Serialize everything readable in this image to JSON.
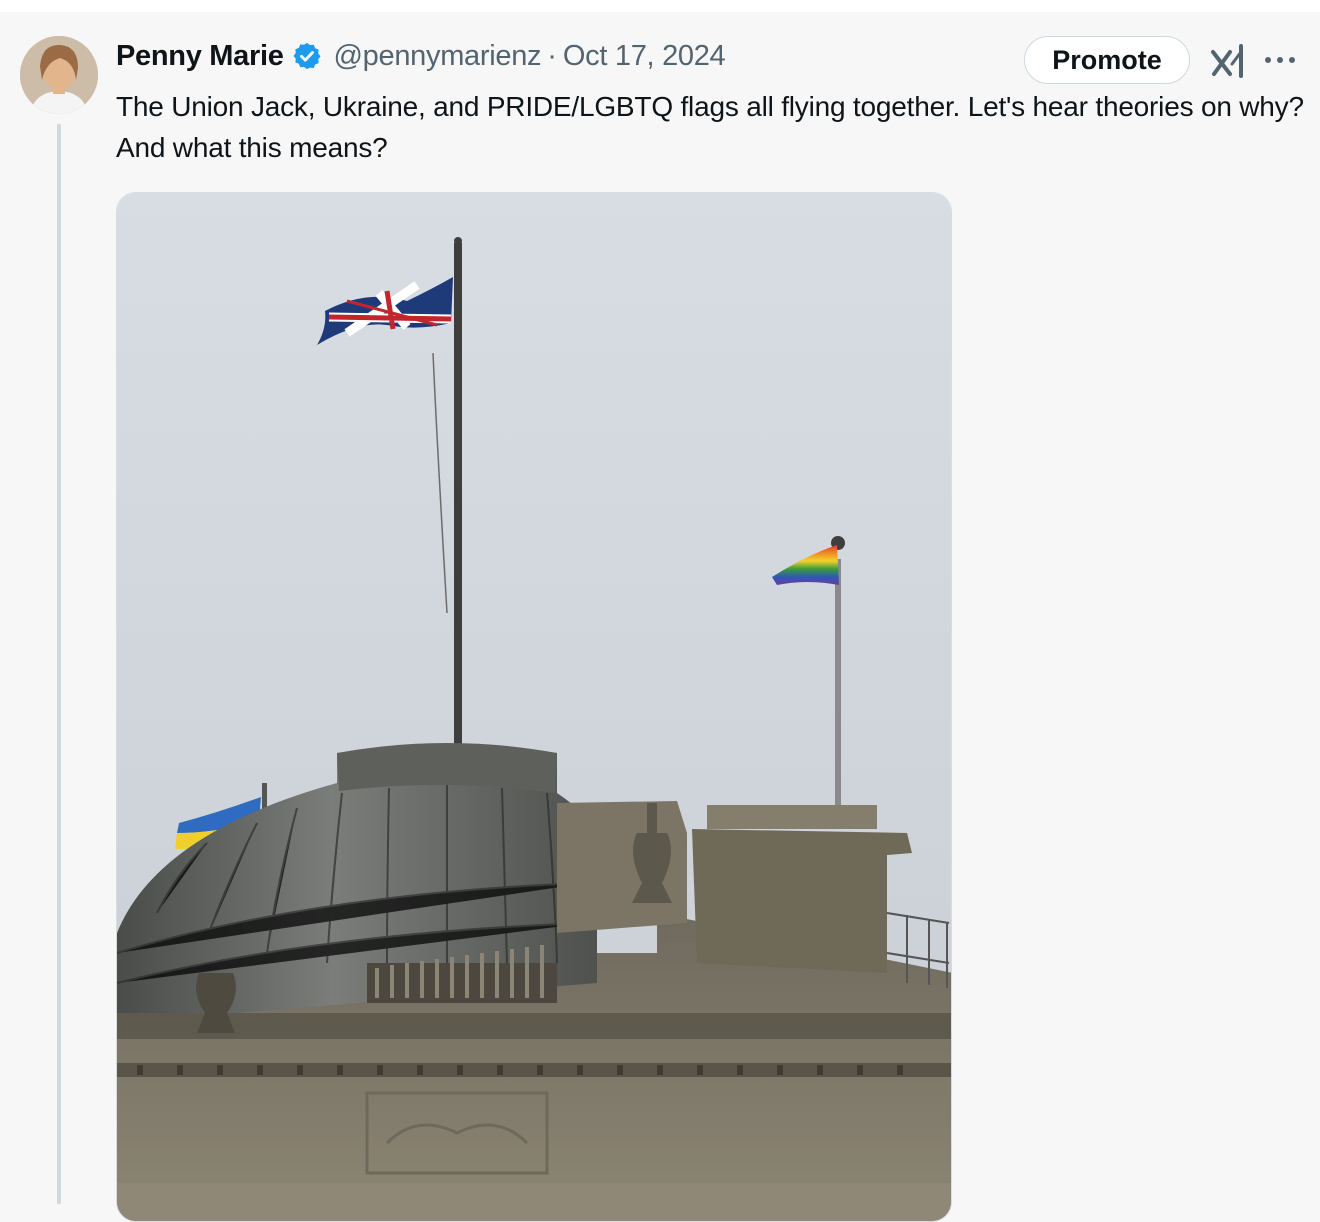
{
  "tweet": {
    "author": {
      "display_name": "Penny Marie",
      "handle": "@pennymarienz",
      "verified": true,
      "avatar_icon": "avatar-photo"
    },
    "separator": "·",
    "date": "Oct 17, 2024",
    "text": "The Union Jack, Ukraine, and PRIDE/LGBTQ flags all flying together. Let's hear theories on why? And what this means?",
    "actions": {
      "promote_label": "Promote",
      "grok_icon": "grok-icon",
      "more_icon": "more-icon"
    },
    "media": {
      "type": "photo",
      "subject": "building-dome-with-flags"
    }
  },
  "colors": {
    "verified_badge": "#1d9bf0",
    "secondary_text": "#536471",
    "thread_line": "#cfd9de"
  }
}
